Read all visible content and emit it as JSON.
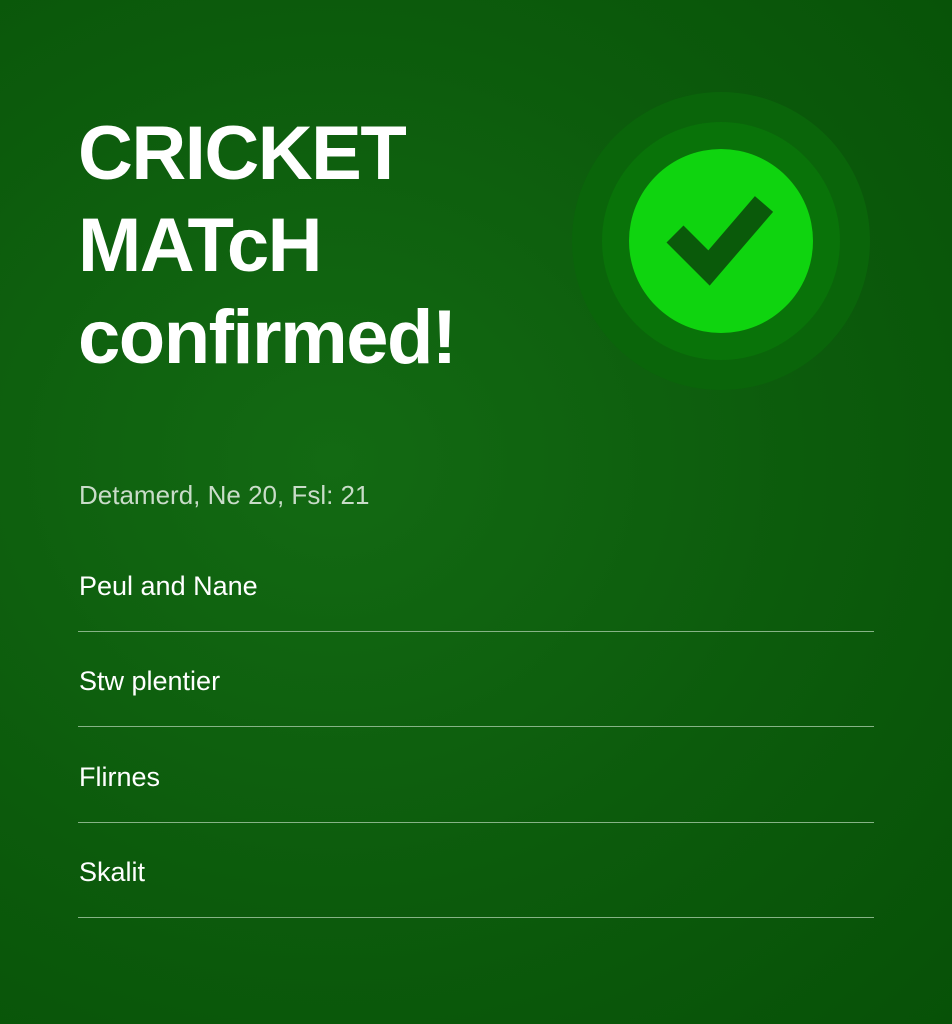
{
  "header": {
    "title_lines": [
      "CRICKET",
      "MATcH",
      "confirmed!"
    ]
  },
  "status": {
    "icon": "checkmark-icon",
    "accent_color": "#0fd40f",
    "ring_color": "#0b7a0b",
    "check_color": "#0a5a0a"
  },
  "details": {
    "date_line": "Detamerd, Ne 20, Fsl: 21"
  },
  "players": {
    "items": [
      {
        "label": "Peul and Nane"
      },
      {
        "label": "Stw plentier"
      },
      {
        "label": "Flirnes"
      },
      {
        "label": "Skalit"
      }
    ]
  },
  "theme": {
    "background": "#0e5f0e",
    "divider": "#86b386"
  }
}
